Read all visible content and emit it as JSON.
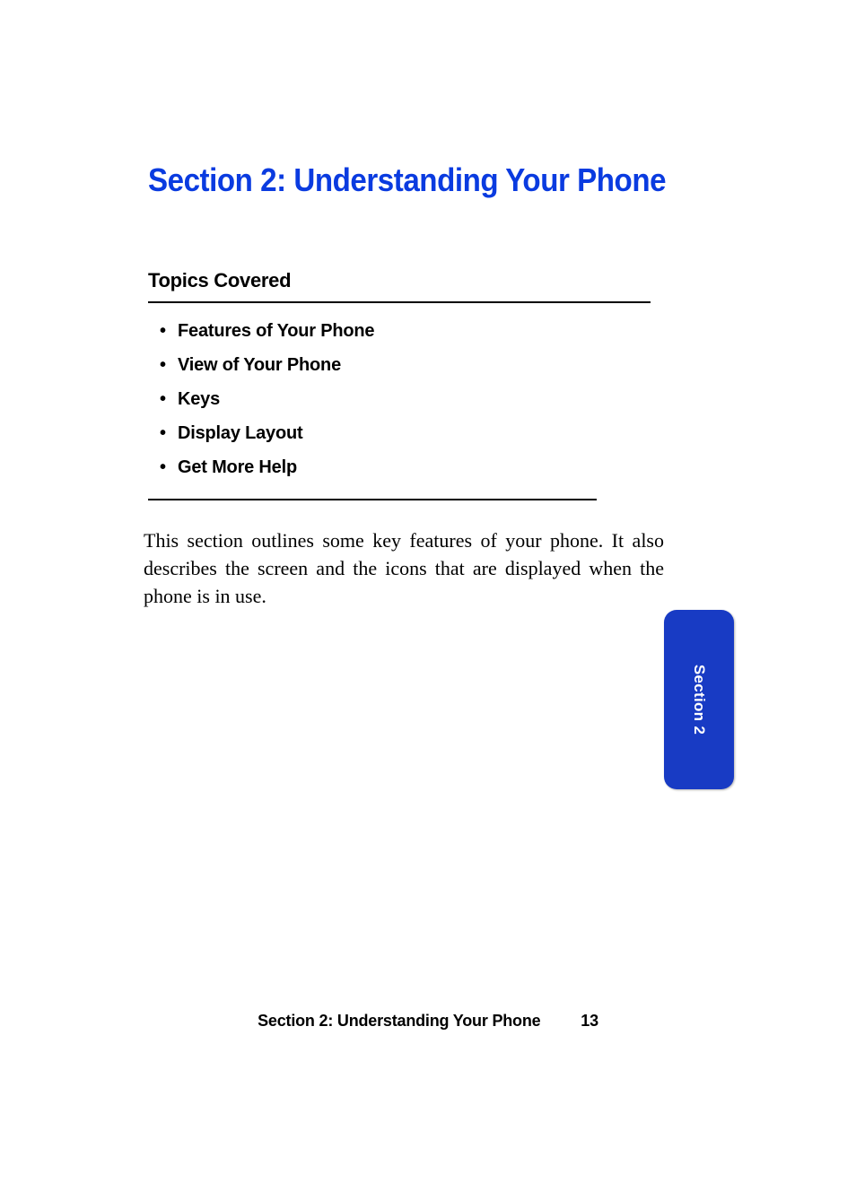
{
  "section_title": "Section 2: Understanding Your Phone",
  "topics_heading": "Topics Covered",
  "topics": [
    "Features of Your Phone",
    "View of Your Phone",
    "Keys",
    "Display Layout",
    "Get More Help"
  ],
  "body_text": "This section outlines some key features of your phone. It also describes the screen and the icons that are displayed when the phone is in use.",
  "side_tab_label": "Section 2",
  "footer_title": "Section 2: Understanding Your Phone",
  "footer_page_number": "13"
}
